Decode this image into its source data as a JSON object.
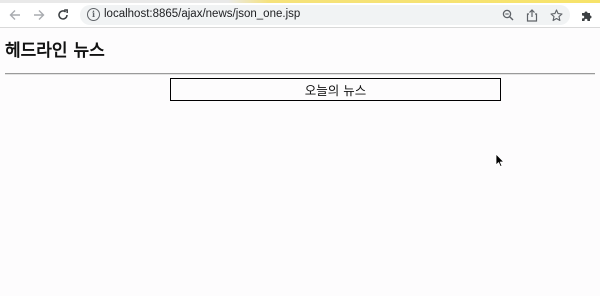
{
  "browser": {
    "url": "localhost:8865/ajax/news/json_one.jsp",
    "back_icon": "back-arrow-icon",
    "forward_icon": "forward-arrow-icon",
    "reload_icon": "reload-icon",
    "site_info_icon": "info-icon",
    "zoom_icon": "zoom-icon",
    "share_icon": "share-icon",
    "bookmark_icon": "star-icon",
    "extensions_icon": "puzzle-icon"
  },
  "page": {
    "title": "헤드라인 뉴스",
    "news_box_label": "오늘의 뉴스"
  },
  "colors": {
    "background": "#fdfcfd",
    "omnibox": "#f1f3f4",
    "top_stripe": "#f7e36a"
  }
}
